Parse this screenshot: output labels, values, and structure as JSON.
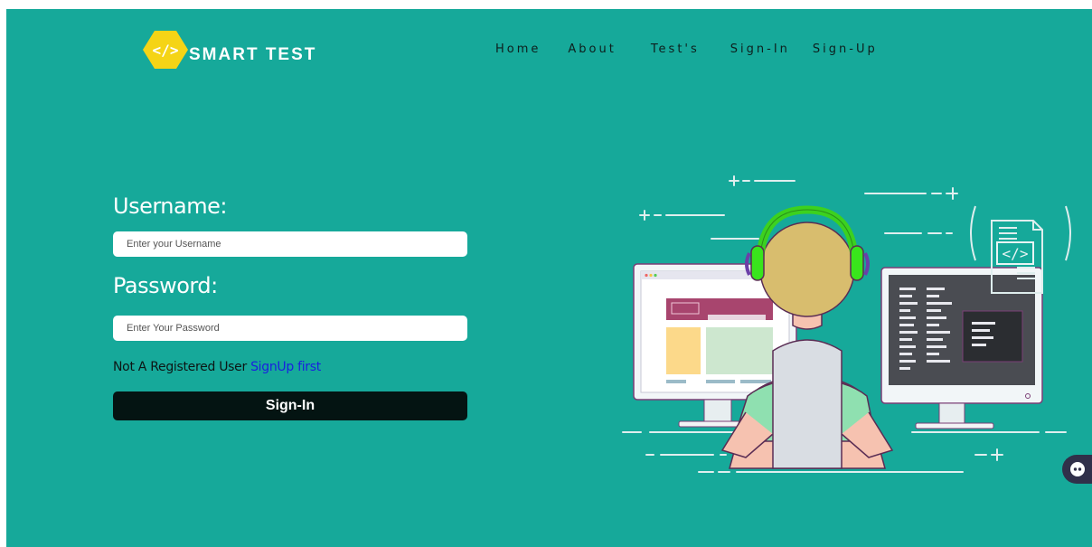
{
  "brand": {
    "name": "SMART TEST",
    "logo_glyph": "</>",
    "logo_color": "#f5d416"
  },
  "nav": {
    "items": [
      "Home",
      "About",
      "Test's",
      "Sign-In",
      "Sign-Up"
    ]
  },
  "form": {
    "username_label": "Username:",
    "username_placeholder": "Enter your Username",
    "password_label": "Password:",
    "password_placeholder": "Enter Your Password",
    "register_text": "Not A Registered User ",
    "register_link": "SignUp first",
    "submit_label": "Sign-In"
  },
  "illustration": {
    "code_glyph": "</>"
  },
  "colors": {
    "background": "#16a99a",
    "button": "#041412",
    "link": "#1a1fe0"
  },
  "chat_widget": {
    "icon": "chatbot-icon"
  }
}
